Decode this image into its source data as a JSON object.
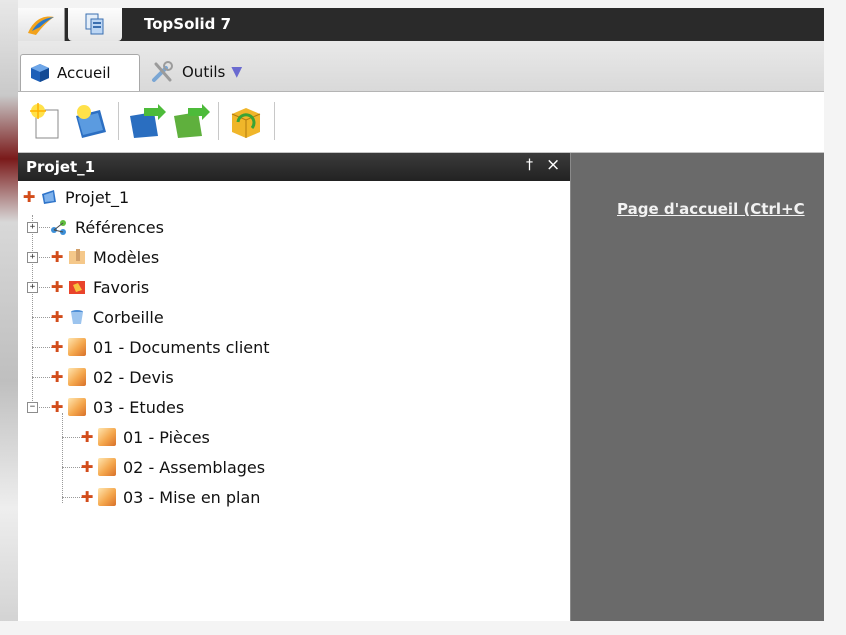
{
  "app": {
    "title": "TopSolid 7"
  },
  "ribbon": {
    "tabs": [
      {
        "label": "Accueil",
        "icon": "accueil-cube-icon"
      },
      {
        "label": "Outils",
        "icon": "tools-icon"
      }
    ]
  },
  "toolbar": {
    "buttons": [
      {
        "name": "new-document-button",
        "icon": "new-document-icon"
      },
      {
        "name": "new-project-button",
        "icon": "new-project-icon"
      },
      {
        "name": "import-button",
        "icon": "import-icon"
      },
      {
        "name": "export-button",
        "icon": "export-icon"
      },
      {
        "name": "package-button",
        "icon": "package-icon"
      }
    ]
  },
  "panel": {
    "title": "Projet_1",
    "pin": "†",
    "close": "×",
    "tree": [
      {
        "label": "Projet_1",
        "level": 0
      },
      {
        "label": "Références",
        "level": 1
      },
      {
        "label": "Modèles",
        "level": 1
      },
      {
        "label": "Favoris",
        "level": 1
      },
      {
        "label": "Corbeille",
        "level": 1
      },
      {
        "label": "01 - Documents client",
        "level": 1
      },
      {
        "label": "02 - Devis",
        "level": 1
      },
      {
        "label": "03 - Etudes",
        "level": 1
      },
      {
        "label": "01 - Pièces",
        "level": 2
      },
      {
        "label": "02 - Assemblages",
        "level": 2
      },
      {
        "label": "03 - Mise en plan",
        "level": 2
      }
    ]
  },
  "main": {
    "home_link": "Page d'accueil (Ctrl+C"
  },
  "colors": {
    "titlebar": "#2a2a2a",
    "right_pane": "#6a6a6a",
    "plus_marker": "#d24c1a"
  }
}
